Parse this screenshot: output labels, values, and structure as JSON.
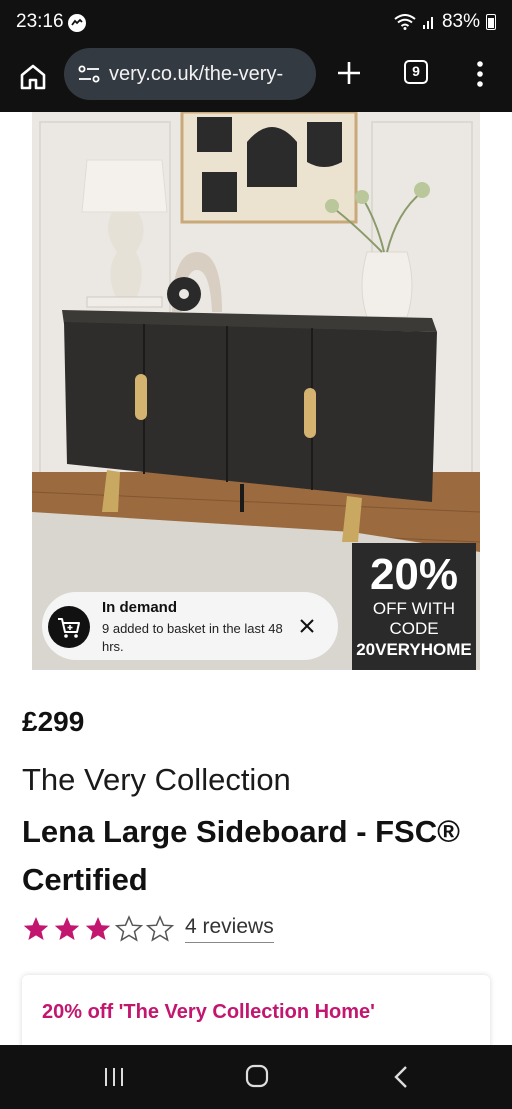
{
  "status_bar": {
    "time": "23:16",
    "battery": "83%"
  },
  "browser": {
    "url": "very.co.uk/the-very-",
    "tab_count": "9"
  },
  "product_image": {
    "promo": {
      "percent": "20%",
      "line1": "OFF WITH",
      "line2": "CODE",
      "code": "20VERYHOME"
    },
    "demand_toast": {
      "title": "In demand",
      "text": "9 added to basket in the last 48 hrs."
    }
  },
  "product": {
    "price": "£299",
    "brand": "The Very Collection",
    "name": "Lena Large Sideboard - FSC® Certified",
    "rating": 3,
    "rating_max": 5,
    "reviews": "4 reviews",
    "offer": "20% off 'The Very Collection Home'"
  },
  "colors": {
    "accent": "#c2166f",
    "dark": "#111111"
  }
}
